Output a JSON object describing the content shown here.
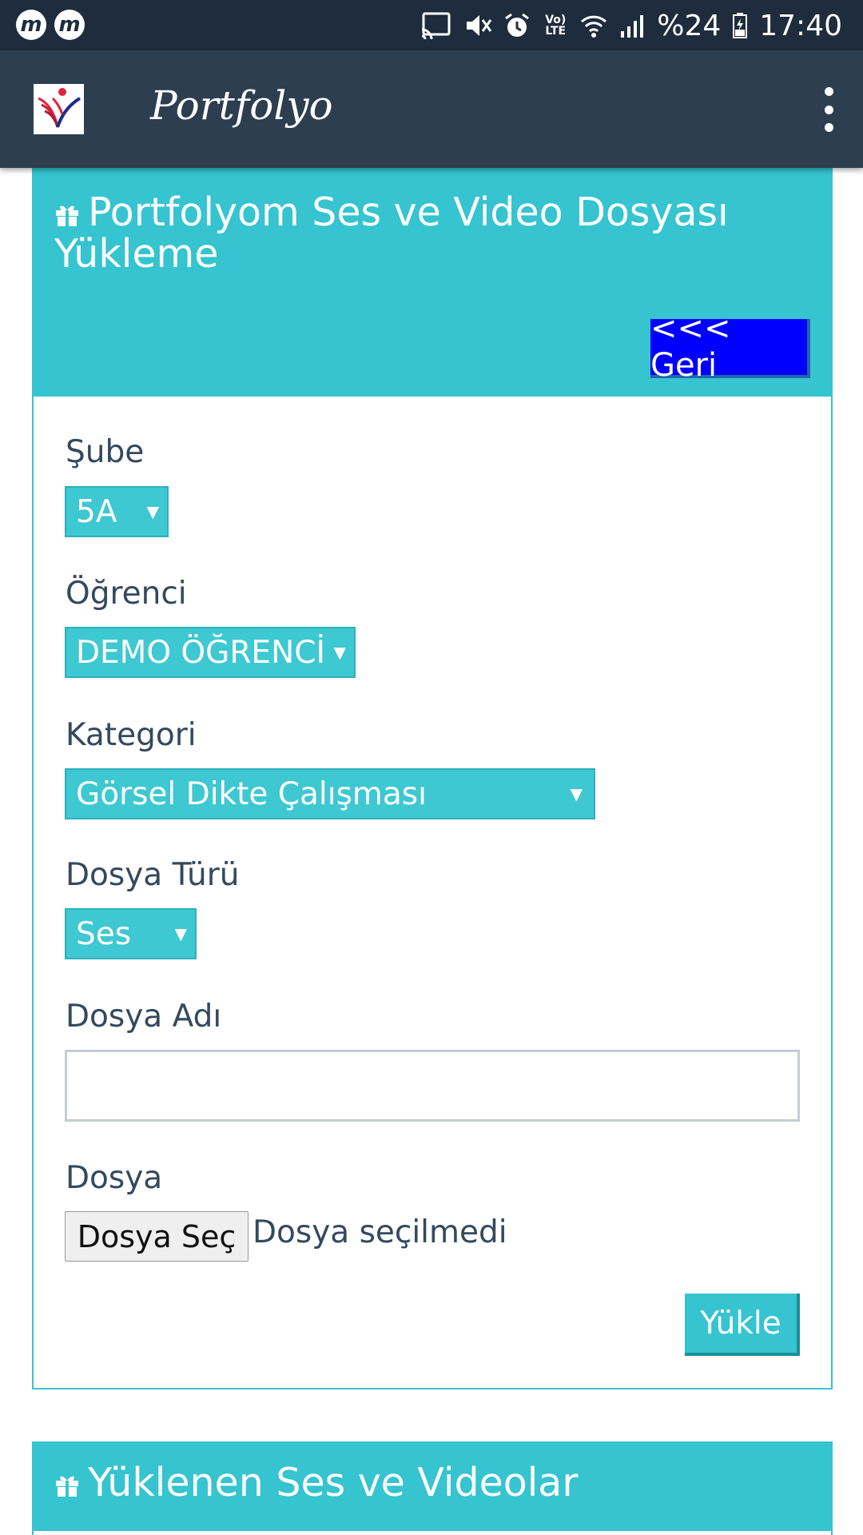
{
  "status_bar": {
    "app_icons": [
      "m",
      "m"
    ],
    "lte_label": "Vo) LTE",
    "battery": "%24",
    "time": "17:40"
  },
  "app_bar": {
    "title": "Portfolyo"
  },
  "upload_panel": {
    "title": "Portfolyom Ses ve Video Dosyası Yükleme",
    "back_button": "<<< Geri",
    "branch_label": "Şube",
    "branch_value": "5A",
    "student_label": "Öğrenci",
    "student_value": "DEMO ÖĞRENCİ",
    "category_label": "Kategori",
    "category_value": "Görsel Dikte Çalışması",
    "file_type_label": "Dosya Türü",
    "file_type_value": "Ses",
    "file_name_label": "Dosya Adı",
    "file_name_value": "",
    "file_label": "Dosya",
    "choose_file_button": "Dosya Seç",
    "file_status": "Dosya seçilmedi",
    "upload_button": "Yükle"
  },
  "uploaded_panel": {
    "title": "Yüklenen Ses ve Videolar"
  },
  "colors": {
    "status_bar": "#1e2c3d",
    "app_bar": "#2d3e50",
    "accent": "#35c4d0",
    "back_button": "#0000ff",
    "text": "#34495e"
  },
  "icons": [
    "cast-icon",
    "mute-icon",
    "alarm-icon",
    "wifi-icon",
    "signal-icon",
    "battery-icon",
    "overflow-menu-icon",
    "gift-icon"
  ]
}
